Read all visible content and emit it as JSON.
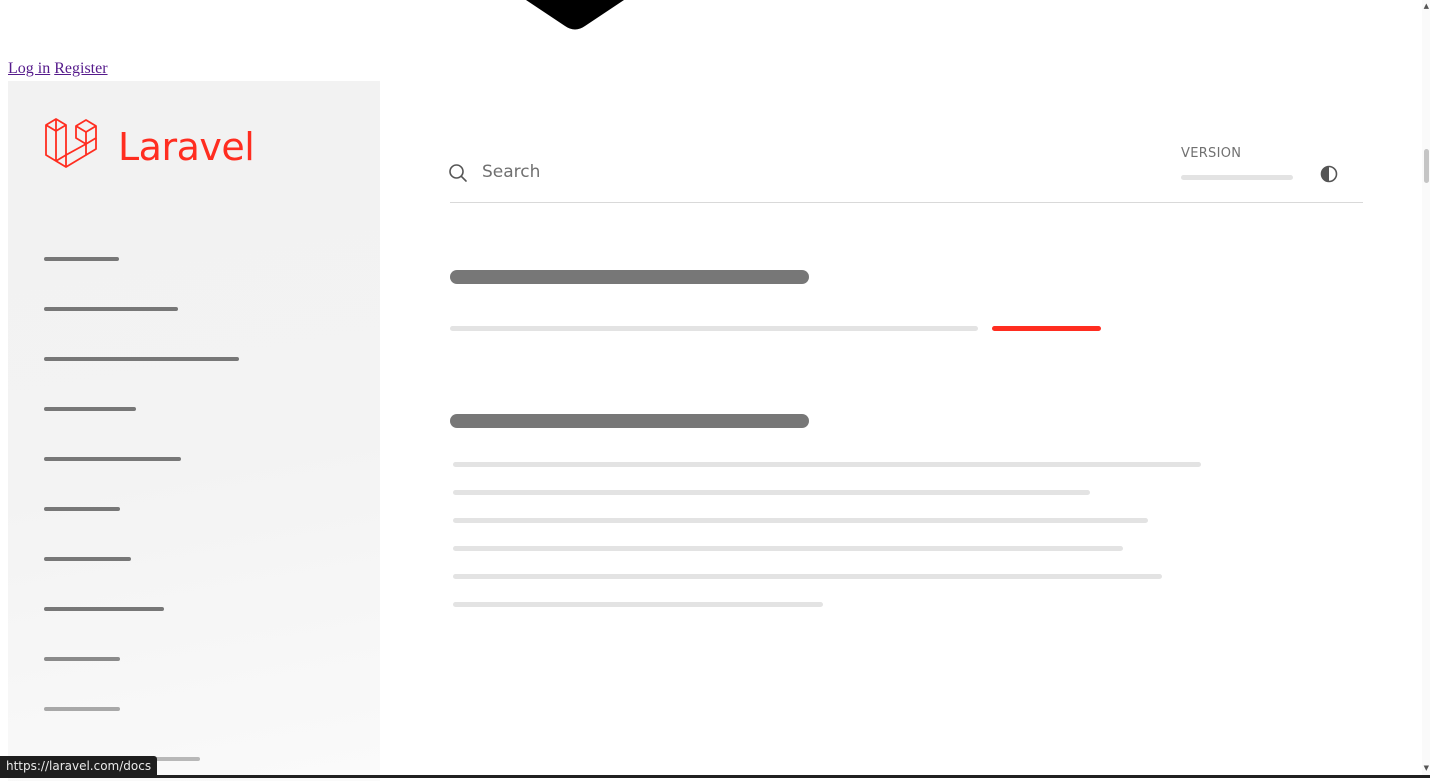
{
  "auth": {
    "login_label": "Log in",
    "register_label": "Register"
  },
  "brand": {
    "name": "Laravel",
    "color": "#ff2d20"
  },
  "search": {
    "placeholder": "Search",
    "icon": "search-icon"
  },
  "version": {
    "label": "VERSION"
  },
  "theme_toggle": {
    "icon": "contrast-icon"
  },
  "status_bar": {
    "url": "https://laravel.com/docs"
  },
  "colors": {
    "skeleton_dark": "#777777",
    "skeleton_light": "#e3e3e3",
    "accent": "#ff2d20"
  }
}
